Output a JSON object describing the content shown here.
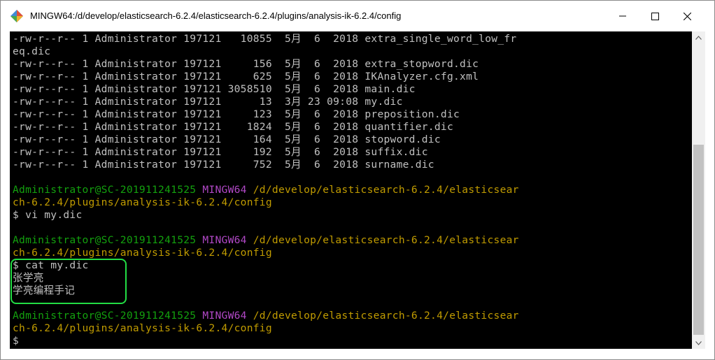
{
  "window": {
    "title": "MINGW64:/d/develop/elasticsearch-6.2.4/elasticsearch-6.2.4/plugins/analysis-ik-6.2.4/config",
    "icon": "mintty-app-icon",
    "buttons": {
      "minimize": "minimize-icon",
      "maximize": "maximize-icon",
      "close": "close-icon"
    }
  },
  "colors": {
    "terminal_bg": "#000000",
    "text": "#c0c0c0",
    "user_host": "#13a10e",
    "shell_name": "#b148c6",
    "path": "#c19c00",
    "highlight_box": "#22dd44"
  },
  "terminal": {
    "lines": [
      {
        "parts": [
          {
            "c": "w",
            "t": "-rw-r--r-- 1 Administrator 197121   10855  5月  6  2018 extra_single_word_low_fr"
          }
        ]
      },
      {
        "parts": [
          {
            "c": "w",
            "t": "eq.dic"
          }
        ]
      },
      {
        "parts": [
          {
            "c": "w",
            "t": "-rw-r--r-- 1 Administrator 197121     156  5月  6  2018 extra_stopword.dic"
          }
        ]
      },
      {
        "parts": [
          {
            "c": "w",
            "t": "-rw-r--r-- 1 Administrator 197121     625  5月  6  2018 IKAnalyzer.cfg.xml"
          }
        ]
      },
      {
        "parts": [
          {
            "c": "w",
            "t": "-rw-r--r-- 1 Administrator 197121 3058510  5月  6  2018 main.dic"
          }
        ]
      },
      {
        "parts": [
          {
            "c": "w",
            "t": "-rw-r--r-- 1 Administrator 197121      13  3月 23 09:08 my.dic"
          }
        ]
      },
      {
        "parts": [
          {
            "c": "w",
            "t": "-rw-r--r-- 1 Administrator 197121     123  5月  6  2018 preposition.dic"
          }
        ]
      },
      {
        "parts": [
          {
            "c": "w",
            "t": "-rw-r--r-- 1 Administrator 197121    1824  5月  6  2018 quantifier.dic"
          }
        ]
      },
      {
        "parts": [
          {
            "c": "w",
            "t": "-rw-r--r-- 1 Administrator 197121     164  5月  6  2018 stopword.dic"
          }
        ]
      },
      {
        "parts": [
          {
            "c": "w",
            "t": "-rw-r--r-- 1 Administrator 197121     192  5月  6  2018 suffix.dic"
          }
        ]
      },
      {
        "parts": [
          {
            "c": "w",
            "t": "-rw-r--r-- 1 Administrator 197121     752  5月  6  2018 surname.dic"
          }
        ]
      },
      {
        "parts": [
          {
            "c": "w",
            "t": ""
          }
        ]
      },
      {
        "parts": [
          {
            "c": "g",
            "t": "Administrator@SC-201911241525"
          },
          {
            "c": "w",
            "t": " "
          },
          {
            "c": "m",
            "t": "MINGW64"
          },
          {
            "c": "w",
            "t": " "
          },
          {
            "c": "y",
            "t": "/d/develop/elasticsearch-6.2.4/elasticsear"
          }
        ]
      },
      {
        "parts": [
          {
            "c": "y",
            "t": "ch-6.2.4/plugins/analysis-ik-6.2.4/config"
          }
        ]
      },
      {
        "parts": [
          {
            "c": "w",
            "t": "$ vi my.dic"
          }
        ]
      },
      {
        "parts": [
          {
            "c": "w",
            "t": ""
          }
        ]
      },
      {
        "parts": [
          {
            "c": "g",
            "t": "Administrator@SC-201911241525"
          },
          {
            "c": "w",
            "t": " "
          },
          {
            "c": "m",
            "t": "MINGW64"
          },
          {
            "c": "w",
            "t": " "
          },
          {
            "c": "y",
            "t": "/d/develop/elasticsearch-6.2.4/elasticsear"
          }
        ]
      },
      {
        "parts": [
          {
            "c": "y",
            "t": "ch-6.2.4/plugins/analysis-ik-6.2.4/config"
          }
        ]
      },
      {
        "parts": [
          {
            "c": "w",
            "t": "$ cat my.dic"
          }
        ]
      },
      {
        "parts": [
          {
            "c": "w",
            "t": "张学亮"
          }
        ]
      },
      {
        "parts": [
          {
            "c": "w",
            "t": "学亮编程手记"
          }
        ]
      },
      {
        "parts": [
          {
            "c": "w",
            "t": ""
          }
        ]
      },
      {
        "parts": [
          {
            "c": "g",
            "t": "Administrator@SC-201911241525"
          },
          {
            "c": "w",
            "t": " "
          },
          {
            "c": "m",
            "t": "MINGW64"
          },
          {
            "c": "w",
            "t": " "
          },
          {
            "c": "y",
            "t": "/d/develop/elasticsearch-6.2.4/elasticsear"
          }
        ]
      },
      {
        "parts": [
          {
            "c": "y",
            "t": "ch-6.2.4/plugins/analysis-ik-6.2.4/config"
          }
        ]
      },
      {
        "parts": [
          {
            "c": "w",
            "t": "$"
          }
        ]
      }
    ]
  },
  "scrollbar": {
    "up": "scroll-up-arrow-icon",
    "down": "scroll-down-arrow-icon"
  }
}
